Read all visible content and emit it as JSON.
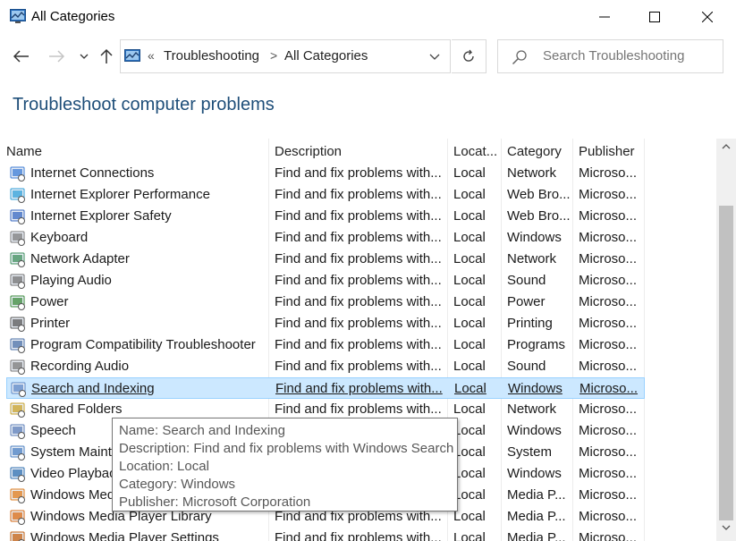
{
  "window": {
    "title": "All Categories",
    "icon": "control-panel-icon",
    "controls": [
      "minimize-icon",
      "maximize-icon",
      "close-icon"
    ]
  },
  "nav": {
    "back_icon": "arrow-left-icon",
    "forward_icon": "arrow-right-icon",
    "recent_icon": "chevron-down-icon",
    "up_icon": "arrow-up-icon"
  },
  "address": {
    "overflow": "«",
    "crumbs": [
      "Troubleshooting",
      "All Categories"
    ],
    "separator": ">"
  },
  "search": {
    "placeholder": "Search Troubleshooting"
  },
  "page": {
    "title": "Troubleshoot computer problems"
  },
  "table": {
    "headers": {
      "name": "Name",
      "description": "Description",
      "location": "Locat...",
      "category": "Category",
      "publisher": "Publisher"
    },
    "rows": [
      {
        "name": "Internet Connections",
        "description": "Find and fix problems with...",
        "location": "Local",
        "category": "Network",
        "publisher": "Microso...",
        "icon": "network-globe-icon"
      },
      {
        "name": "Internet Explorer Performance",
        "description": "Find and fix problems with...",
        "location": "Local",
        "category": "Web Bro...",
        "publisher": "Microso...",
        "icon": "ie-performance-icon"
      },
      {
        "name": "Internet Explorer Safety",
        "description": "Find and fix problems with...",
        "location": "Local",
        "category": "Web Bro...",
        "publisher": "Microso...",
        "icon": "ie-safety-icon"
      },
      {
        "name": "Keyboard",
        "description": "Find and fix problems with...",
        "location": "Local",
        "category": "Windows",
        "publisher": "Microso...",
        "icon": "keyboard-icon"
      },
      {
        "name": "Network Adapter",
        "description": "Find and fix problems with...",
        "location": "Local",
        "category": "Network",
        "publisher": "Microso...",
        "icon": "network-adapter-icon"
      },
      {
        "name": "Playing Audio",
        "description": "Find and fix problems with...",
        "location": "Local",
        "category": "Sound",
        "publisher": "Microso...",
        "icon": "audio-icon"
      },
      {
        "name": "Power",
        "description": "Find and fix problems with...",
        "location": "Local",
        "category": "Power",
        "publisher": "Microso...",
        "icon": "power-icon"
      },
      {
        "name": "Printer",
        "description": "Find and fix problems with...",
        "location": "Local",
        "category": "Printing",
        "publisher": "Microso...",
        "icon": "printer-icon"
      },
      {
        "name": "Program Compatibility Troubleshooter",
        "description": "Find and fix problems with...",
        "location": "Local",
        "category": "Programs",
        "publisher": "Microso...",
        "icon": "program-compat-icon"
      },
      {
        "name": "Recording Audio",
        "description": "Find and fix problems with...",
        "location": "Local",
        "category": "Sound",
        "publisher": "Microso...",
        "icon": "microphone-icon"
      },
      {
        "name": "Search and Indexing",
        "description": "Find and fix problems with...",
        "location": "Local",
        "category": "Windows",
        "publisher": "Microso...",
        "icon": "search-indexing-icon"
      },
      {
        "name": "Shared Folders",
        "description": "Find and fix problems with...",
        "location": "Local",
        "category": "Network",
        "publisher": "Microso...",
        "icon": "shared-folder-icon"
      },
      {
        "name": "Speech",
        "description": "",
        "location": "Local",
        "category": "Windows",
        "publisher": "Microso...",
        "icon": "speech-icon"
      },
      {
        "name": "System Mainte",
        "description": "",
        "location": "Local",
        "category": "System",
        "publisher": "Microso...",
        "icon": "system-maintenance-icon"
      },
      {
        "name": "Video Playbac",
        "description": "",
        "location": "Local",
        "category": "Windows",
        "publisher": "Microso...",
        "icon": "video-playback-icon"
      },
      {
        "name": "Windows Med",
        "description": "",
        "location": "Local",
        "category": "Media P...",
        "publisher": "Microso...",
        "icon": "media-player-icon"
      },
      {
        "name": "Windows Media Player Library",
        "description": "Find and fix problems with...",
        "location": "Local",
        "category": "Media P...",
        "publisher": "Microso...",
        "icon": "media-library-icon"
      },
      {
        "name": "Windows Media Player Settings",
        "description": "Find and fix problems with...",
        "location": "Local",
        "category": "Media P...",
        "publisher": "Microso...",
        "icon": "media-settings-icon"
      }
    ],
    "selected_index": 10
  },
  "tooltip": {
    "name": "Name: Search and Indexing",
    "description": "Description: Find and fix problems with Windows Search",
    "location": "Location: Local",
    "category": "Category: Windows",
    "publisher": "Publisher: Microsoft Corporation"
  },
  "colors": {
    "title_blue": "#1e4e79",
    "selection": "#cce8ff",
    "selection_border": "#99d1ff"
  }
}
